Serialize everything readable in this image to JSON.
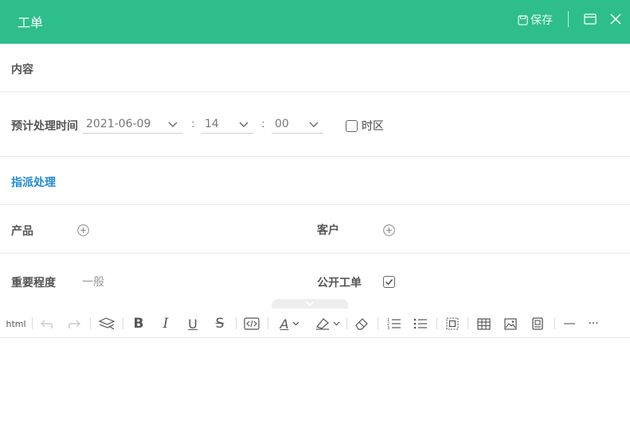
{
  "header": {
    "title": "工单",
    "save_label": "保存",
    "icons": [
      "save-icon",
      "maximize-icon",
      "close-icon"
    ],
    "bg_color": "#2dbe8c"
  },
  "form": {
    "content_label": "内容",
    "schedule": {
      "label": "预计处理时间",
      "date": "2021-06-09",
      "hour": "14",
      "minute": "00",
      "separator": ":",
      "timezone_label": "时区",
      "timezone_checked": false
    },
    "assign_label": "指派处理",
    "product_label": "产品",
    "customer_label": "客户",
    "priority": {
      "label": "重要程度",
      "value": "一般"
    },
    "public": {
      "label": "公开工单",
      "checked": true
    }
  },
  "toolbar": {
    "html_label": "html",
    "buttons": [
      "undo-icon",
      "redo-icon",
      "clear-format-icon",
      "bold-icon",
      "italic-icon",
      "underline-icon",
      "strikethrough-icon",
      "code-icon",
      "font-color-icon",
      "highlight-icon",
      "eraser-icon",
      "ordered-list-icon",
      "unordered-list-icon",
      "select-all-icon",
      "table-icon",
      "image-icon",
      "video-icon",
      "horizontal-rule-icon",
      "more-icon"
    ],
    "bold": "B",
    "italic": "I",
    "underline": "U",
    "strike": "S",
    "font_color": "A",
    "more": "···"
  }
}
